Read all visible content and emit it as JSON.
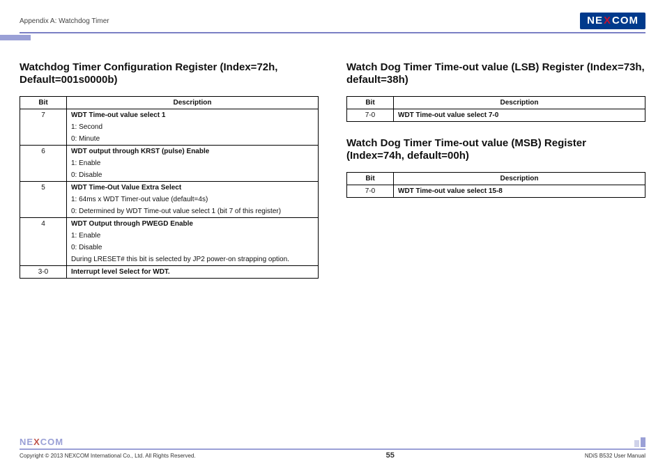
{
  "header": {
    "appendix": "Appendix A: Watchdog Timer",
    "brand_pre": "NE",
    "brand_x": "X",
    "brand_post": "COM"
  },
  "left": {
    "title": "Watchdog Timer Configuration Register (Index=72h, Default=001s0000b)",
    "th_bit": "Bit",
    "th_desc": "Description",
    "row7_bit": "7",
    "row7_title": "WDT Time-out value select 1",
    "row7_l1": "1: Second",
    "row7_l2": "0: Minute",
    "row6_bit": "6",
    "row6_title": "WDT output through KRST (pulse) Enable",
    "row6_l1": "1: Enable",
    "row6_l2": "0: Disable",
    "row5_bit": "5",
    "row5_title": "WDT Time-Out Value Extra Select",
    "row5_l1": "1: 64ms x WDT Timer-out value (default=4s)",
    "row5_l2": "0: Determined by WDT Time-out value select 1 (bit 7 of this register)",
    "row4_bit": "4",
    "row4_title": "WDT Output through PWEGD Enable",
    "row4_l1": "1: Enable",
    "row4_l2": "0: Disable",
    "row4_l3": "During LRESET# this bit is selected by JP2 power-on strapping option.",
    "row30_bit": "3-0",
    "row30_title": "Interrupt level Select for WDT."
  },
  "right": {
    "lsb_title": "Watch Dog Timer Time-out value (LSB) Register (Index=73h, default=38h)",
    "lsb_th_bit": "Bit",
    "lsb_th_desc": "Description",
    "lsb_bit": "7-0",
    "lsb_desc": "WDT Time-out value select 7-0",
    "msb_title": "Watch Dog Timer Time-out value (MSB) Register (Index=74h, default=00h)",
    "msb_th_bit": "Bit",
    "msb_th_desc": "Description",
    "msb_bit": "7-0",
    "msb_desc": "WDT Time-out value select 15-8"
  },
  "footer": {
    "brand_pre": "NE",
    "brand_x": "X",
    "brand_post": "COM",
    "copyright": "Copyright © 2013 NEXCOM International Co., Ltd. All Rights Reserved.",
    "page": "55",
    "manual": "NDiS B532 User Manual"
  }
}
